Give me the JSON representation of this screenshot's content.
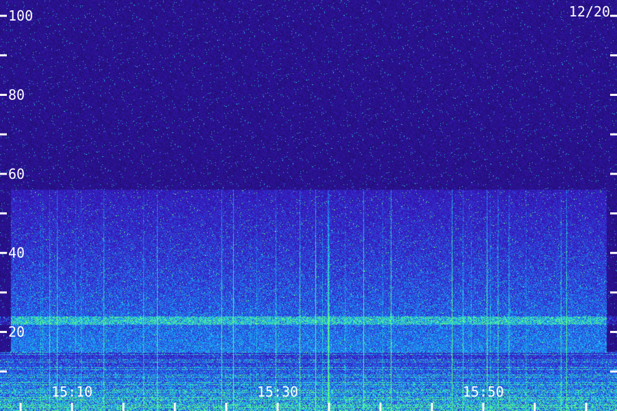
{
  "date_label": "12/20",
  "colors": {
    "background": "#1a0d5c",
    "band_low": "#3b2bd6",
    "band_bright": "#27d3ff",
    "band_peak": "#5dff8a",
    "labels": "#ffffff"
  },
  "chart_data": {
    "type": "heatmap",
    "title": "",
    "xlabel": "",
    "ylabel": "",
    "date": "12/20",
    "xlim": [
      "15:03",
      "16:03"
    ],
    "ylim": [
      0,
      104
    ],
    "y_ticks": [
      {
        "value": 100,
        "label": "100"
      },
      {
        "value": 90,
        "label": ""
      },
      {
        "value": 80,
        "label": "80"
      },
      {
        "value": 70,
        "label": ""
      },
      {
        "value": 60,
        "label": "60"
      },
      {
        "value": 50,
        "label": ""
      },
      {
        "value": 40,
        "label": "40"
      },
      {
        "value": 30,
        "label": ""
      },
      {
        "value": 20,
        "label": "20"
      },
      {
        "value": 10,
        "label": ""
      }
    ],
    "x_ticks": [
      {
        "value": "15:05",
        "label": ""
      },
      {
        "value": "15:10",
        "label": "15:10"
      },
      {
        "value": "15:15",
        "label": ""
      },
      {
        "value": "15:20",
        "label": ""
      },
      {
        "value": "15:25",
        "label": ""
      },
      {
        "value": "15:30",
        "label": "15:30"
      },
      {
        "value": "15:35",
        "label": ""
      },
      {
        "value": "15:40",
        "label": ""
      },
      {
        "value": "15:45",
        "label": ""
      },
      {
        "value": "15:50",
        "label": "15:50"
      },
      {
        "value": "15:55",
        "label": ""
      },
      {
        "value": "16:00",
        "label": ""
      }
    ],
    "features": [
      {
        "name": "low-frequency band",
        "y_range": [
          0,
          15
        ],
        "intensity": "high"
      },
      {
        "name": "narrow band",
        "y_range": [
          22,
          24
        ],
        "intensity": "medium"
      },
      {
        "name": "broadband region",
        "x_range": [
          "15:04",
          "16:02"
        ],
        "y_range": [
          15,
          56
        ],
        "intensity": "medium"
      }
    ],
    "grid": false,
    "legend": "none"
  }
}
